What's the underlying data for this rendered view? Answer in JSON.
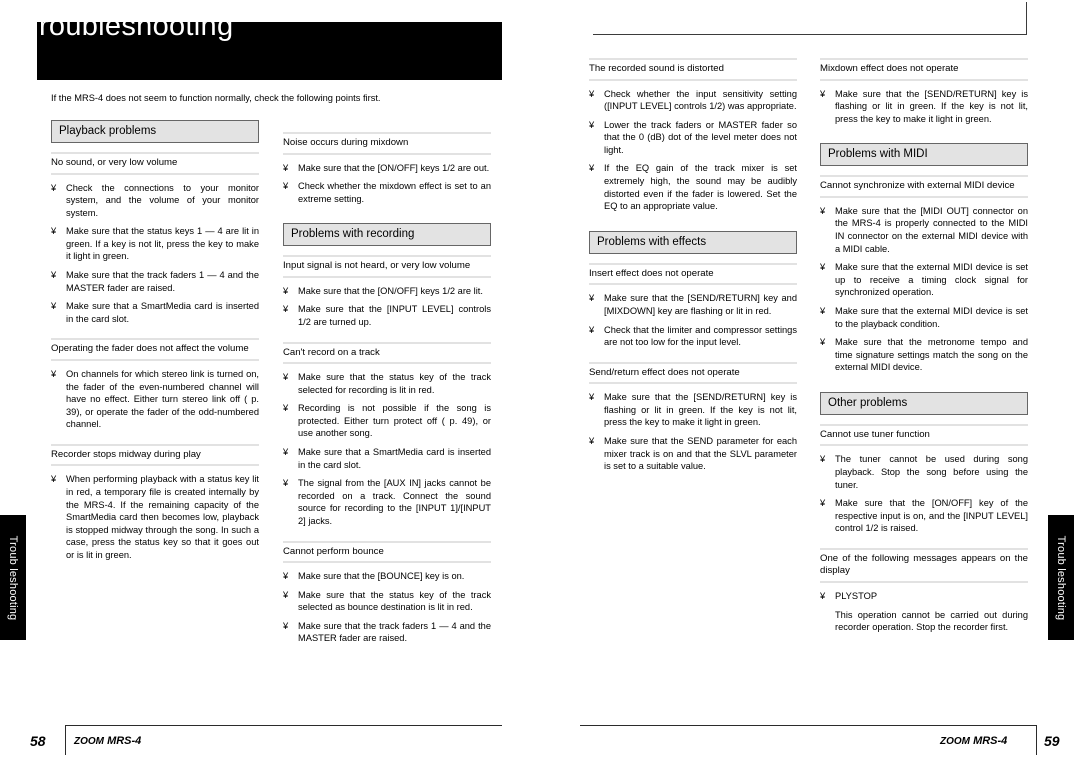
{
  "document": {
    "title": "Troubleshooting",
    "intro": "If the MRS-4 does not seem to function normally, check the following points first.",
    "bullet_mark": "¥",
    "side_tab_label": "Troub leshooting"
  },
  "footer": {
    "left_page_number": "58",
    "right_page_number": "59",
    "brand_zoom": "ZOOM",
    "brand_model": "MRS-4"
  },
  "sections": {
    "playback": {
      "heading": "Playback problems",
      "groups": [
        {
          "title": "No sound, or very low volume",
          "items": [
            "Check the connections to your monitor system, and the volume of your monitor system.",
            "Make sure that the status keys 1 — 4 are lit in green. If a key is not lit, press the key to make it light in green.",
            "Make sure that the track faders 1 — 4 and the MASTER fader are raised.",
            "Make sure that a SmartMedia card is inserted in the card slot."
          ]
        },
        {
          "title": "Operating the fader does not affect the volume",
          "items": [
            "On channels for which stereo link is turned on, the fader of the even-numbered channel will have no effect. Either turn stereo link off (  p. 39), or operate the fader of the odd-numbered channel."
          ]
        },
        {
          "title": "Recorder stops midway during play",
          "items": [
            "When performing playback with a status key lit in red, a temporary file is created internally by the MRS-4. If the remaining capacity of the SmartMedia card then becomes low, playback is stopped midway through the song. In such a case, press the status key so that it goes out or is lit in green."
          ]
        }
      ]
    },
    "mixdown_noise": {
      "groups": [
        {
          "title": "Noise occurs during mixdown",
          "items": [
            "Make sure that the [ON/OFF] keys 1/2 are out.",
            "Check whether the mixdown effect is set to an extreme setting."
          ]
        }
      ]
    },
    "recording": {
      "heading": "Problems with recording",
      "groups": [
        {
          "title": "Input signal is not heard, or very low volume",
          "items": [
            "Make sure that the [ON/OFF] keys 1/2 are lit.",
            "Make sure that the [INPUT LEVEL] controls 1/2 are turned up."
          ]
        },
        {
          "title": "Can't record on a track",
          "items": [
            "Make sure that the status key of the track selected for recording is lit in red.",
            "Recording is not possible if the song is protected. Either turn protect off (    p. 49), or use another song.",
            "Make sure that a SmartMedia card is inserted in the card slot.",
            "The signal from the [AUX IN] jacks cannot be recorded on a track. Connect the sound source for recording to the [INPUT 1]/[INPUT 2] jacks."
          ]
        },
        {
          "title": "Cannot perform bounce",
          "items": [
            "Make sure that the [BOUNCE] key is on.",
            "Make sure that the status key of the track selected as bounce destination is lit in red.",
            "Make sure that the track faders 1 — 4 and the MASTER fader are raised."
          ]
        }
      ]
    },
    "distortion": {
      "groups": [
        {
          "title": "The recorded sound is distorted",
          "items": [
            "Check whether the input sensitivity setting ([INPUT LEVEL] controls 1/2) was appropriate.",
            "Lower the track faders or MASTER fader so that the 0 (dB) dot of the level meter does not light.",
            "If the EQ gain of the track mixer is set extremely high, the sound may be audibly distorted even if the fader is lowered. Set the EQ to an appropriate value."
          ]
        }
      ]
    },
    "effects": {
      "heading": "Problems with effects",
      "groups": [
        {
          "title": "Insert effect does not operate",
          "items": [
            "Make sure that the [SEND/RETURN] key and [MIXDOWN] key are flashing or lit in red.",
            "Check that the limiter and compressor settings are not too low for the input level."
          ]
        },
        {
          "title": "Send/return effect does not operate",
          "items": [
            "Make sure that the [SEND/RETURN] key is flashing or lit in green. If the key is not lit, press the key to make it light in green.",
            "Make sure that the SEND parameter for each mixer track is on and that the SLVL parameter is set to a suitable value."
          ]
        }
      ]
    },
    "mixdown_effect": {
      "groups": [
        {
          "title": "Mixdown effect does not operate",
          "items": [
            "Make sure that the [SEND/RETURN] key is flashing or lit in green. If the key is not lit, press the key to make it light in green."
          ]
        }
      ]
    },
    "midi": {
      "heading": "Problems with MIDI",
      "groups": [
        {
          "title": "Cannot synchronize with external MIDI device",
          "items": [
            "Make sure that the [MIDI OUT] connector on the MRS-4 is properly connected to the MIDI IN connector on the external MIDI device with a MIDI cable.",
            "Make sure that the external MIDI device is set up to receive a timing clock signal for synchronized operation.",
            "Make sure that the external MIDI device is set to the playback condition.",
            "Make sure that the metronome tempo and time signature settings match the song on the external MIDI device."
          ]
        }
      ]
    },
    "other": {
      "heading": "Other problems",
      "groups": [
        {
          "title": "Cannot use tuner function",
          "items": [
            "The tuner cannot be used during song playback. Stop the song before using the tuner.",
            "Make sure that the [ON/OFF] key of the respective input is on, and the [INPUT LEVEL] control 1/2 is raised."
          ]
        },
        {
          "title": "One of the following messages appears on the display",
          "items": [
            "PLYSTOP"
          ],
          "sub_paragraphs": [
            "This operation cannot be carried out during recorder operation. Stop the recorder first."
          ]
        }
      ]
    }
  }
}
